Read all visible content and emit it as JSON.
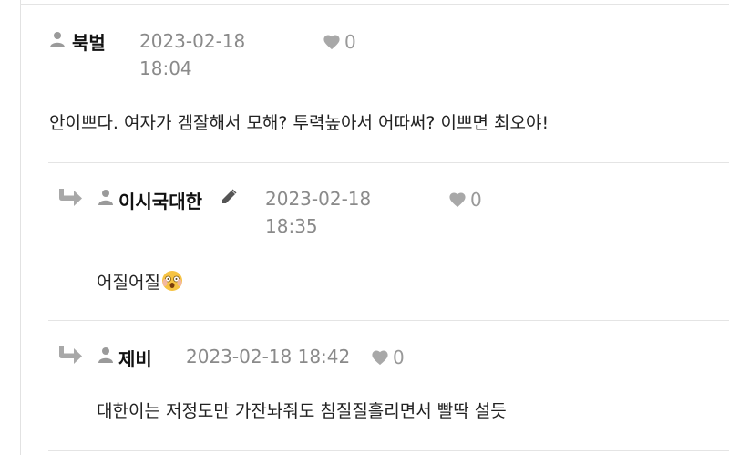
{
  "comments": [
    {
      "author": "북벌",
      "date_line1": "2023-02-18",
      "date_line2": "18:04",
      "likes": "0",
      "text": "안이쁘다. 여자가 겜잘해서 모해? 투력높아서 어따써? 이쁘면 최오야!"
    },
    {
      "author": "이시국대한",
      "date_line1": "2023-02-18",
      "date_line2": "18:35",
      "likes": "0",
      "text": "어질어질",
      "emoji": "dizzy-face-emoji"
    },
    {
      "author": "제비",
      "date": "2023-02-18 18:42",
      "likes": "0",
      "text": "대한이는 저정도만 가잔놔줘도 침질질흘리면서 빨딱 설듯"
    }
  ],
  "icons": {
    "user": "user-icon",
    "heart": "heart-icon",
    "reply": "reply-arrow-icon",
    "edit": "pencil-icon"
  },
  "colors": {
    "muted": "#8a8a8a",
    "icon": "#9a9a9a",
    "divider": "#e4e4e4"
  }
}
